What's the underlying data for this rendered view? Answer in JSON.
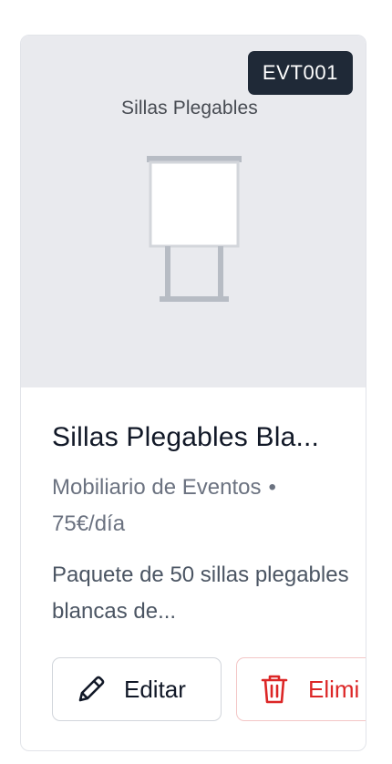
{
  "product": {
    "sku": "EVT001",
    "image_caption": "Sillas Plegables",
    "title": "Sillas Plegables Bla...",
    "category": "Mobiliario de Eventos",
    "separator": "•",
    "price": "75€/día",
    "description": "Paquete de 50 sillas plegables blancas de..."
  },
  "actions": {
    "edit_label": "Editar",
    "delete_label": "Elimi"
  },
  "icons": {
    "edit": "pencil-icon",
    "delete": "trash-icon"
  },
  "colors": {
    "badge_bg": "#1f2937",
    "media_bg": "#e9eaee",
    "delete_accent": "#dc2626"
  }
}
